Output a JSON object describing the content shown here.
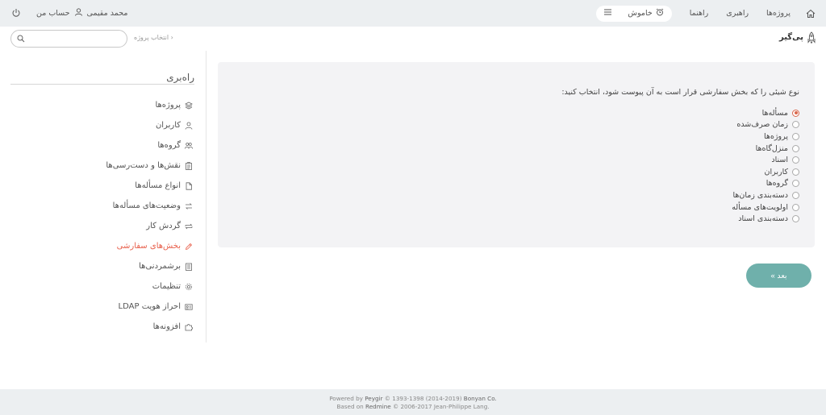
{
  "topbar": {
    "nav": [
      "پروژه‌ها",
      "راهبری",
      "راهنما"
    ],
    "status_label": "خاموش",
    "user_name": "محمد مقیمی",
    "my_account": "حساب من"
  },
  "header": {
    "brand": "پی‌گیر",
    "project_select": "انتخاب پروژه",
    "search_placeholder": ""
  },
  "sidebar": {
    "title": "راه‌بری",
    "items": [
      {
        "label": "پروژه‌ها",
        "icon": "layers-icon"
      },
      {
        "label": "کاربران",
        "icon": "user-icon"
      },
      {
        "label": "گروه‌ها",
        "icon": "group-icon"
      },
      {
        "label": "نقش‌ها و دست‌رسی‌ها",
        "icon": "clipboard-icon"
      },
      {
        "label": "انواع مسأله‌ها",
        "icon": "file-icon"
      },
      {
        "label": "وضعیت‌های مسأله‌ها",
        "icon": "arrows-icon"
      },
      {
        "label": "گردش کار",
        "icon": "swap-icon"
      },
      {
        "label": "بخش‌های سفارشی",
        "icon": "pencil-icon"
      },
      {
        "label": "برشمردنی‌ها",
        "icon": "list-icon"
      },
      {
        "label": "تنظیمات",
        "icon": "gear-icon"
      },
      {
        "label": "احراز هویت LDAP",
        "icon": "idcard-icon"
      },
      {
        "label": "افزونه‌ها",
        "icon": "puzzle-icon"
      }
    ],
    "active_index": 7
  },
  "main": {
    "question": "نوع شیئی را که بخش سفارشی قرار است به آن پیوست شود، انتخاب کنید:",
    "options": [
      "مسأله‌ها",
      "زمان صرف‌شده",
      "پروژه‌ها",
      "منزل‌گاه‌ها",
      "اسناد",
      "کاربران",
      "گروه‌ها",
      "دسته‌بندی زمان‌ها",
      "اولویت‌های مسأله",
      "دسته‌بندی اسناد"
    ],
    "selected_index": 0,
    "next_label": "بعد »"
  },
  "footer": {
    "line1_prefix": "Powered by",
    "line1_link": "Peygir",
    "line1_mid": "© 1393-1398 (2014-2019)",
    "line1_company": "Bonyan Co.",
    "line2_prefix": "Based on",
    "line2_link": "Redmine",
    "line2_rest": "© 2006-2017 Jean-Philippe Lang."
  },
  "colors": {
    "accent": "#e8604c",
    "button": "#6fb0ab",
    "topbar": "#eceff1",
    "panel": "#f3f3f5"
  }
}
